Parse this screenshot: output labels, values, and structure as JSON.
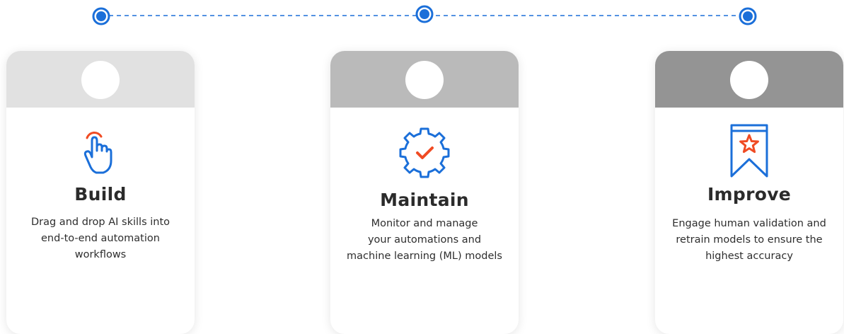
{
  "colors": {
    "accent_blue": "#1b6fd9",
    "accent_red": "#f04b23",
    "header_build": "#e1e1e1",
    "header_maintain": "#bababa",
    "header_improve": "#949494"
  },
  "timeline": {
    "nodes": [
      "step-1",
      "step-2",
      "step-3"
    ]
  },
  "cards": [
    {
      "icon": "touch-hand-icon",
      "title": "Build",
      "desc_lines": [
        "Drag and drop AI skills into",
        "end-to-end automation",
        "workflows"
      ]
    },
    {
      "icon": "gear-check-icon",
      "title": "Maintain",
      "desc_lines": [
        "Monitor and manage",
        "your automations and",
        "machine learning (ML) models"
      ]
    },
    {
      "icon": "ribbon-star-icon",
      "title": "Improve",
      "desc_lines": [
        "Engage human validation and",
        "retrain models to ensure the",
        "highest accuracy"
      ]
    }
  ]
}
